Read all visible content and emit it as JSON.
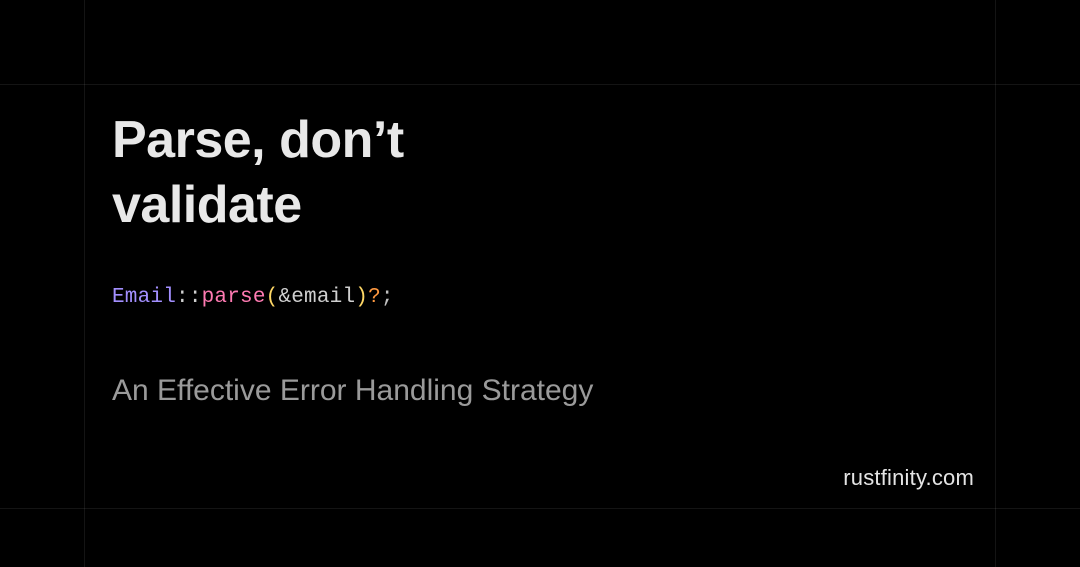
{
  "title": "Parse, don’t validate",
  "code": {
    "type": "Email",
    "sep": "::",
    "fn": "parse",
    "open": "(",
    "arg": "&email",
    "close": ")",
    "qmark": "?",
    "semi": ";"
  },
  "subtitle": "An Effective Error Handling Strategy",
  "site": "rustfinity.com"
}
